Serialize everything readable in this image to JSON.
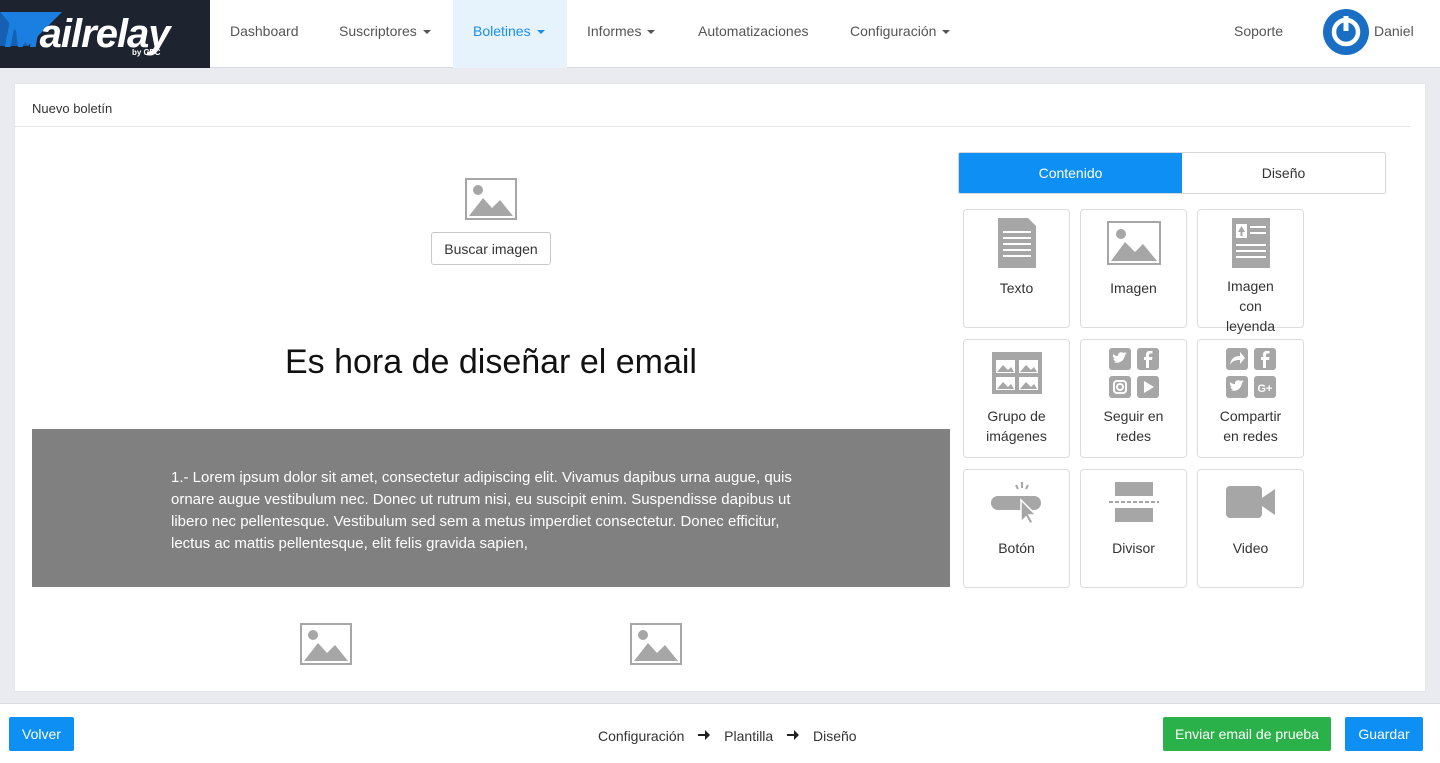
{
  "brand": {
    "name_start": "M",
    "name_rest": "ailrelay",
    "byline": "by CPC"
  },
  "nav": {
    "items": [
      {
        "label": "Dashboard",
        "dropdown": false
      },
      {
        "label": "Suscriptores",
        "dropdown": true
      },
      {
        "label": "Boletines",
        "dropdown": true,
        "active": true
      },
      {
        "label": "Informes",
        "dropdown": true
      },
      {
        "label": "Automatizaciones",
        "dropdown": false
      },
      {
        "label": "Configuración",
        "dropdown": true
      }
    ],
    "support": "Soporte",
    "user": "Daniel"
  },
  "page": {
    "title": "Nuevo boletín"
  },
  "canvas": {
    "search_image_button": "Buscar imagen",
    "heading": "Es hora de diseñar el email",
    "text_block": "1.- Lorem ipsum dolor sit amet, consectetur adipiscing elit. Vivamus dapibus urna augue, quis ornare augue vestibulum nec. Donec ut rutrum nisi, eu suscipit enim. Suspendisse dapibus ut libero nec pellentesque. Vestibulum sed sem a metus imperdiet consectetur. Donec efficitur, lectus ac mattis pellentesque, elit felis gravida sapien,"
  },
  "panel": {
    "tabs": [
      {
        "label": "Contenido",
        "active": true
      },
      {
        "label": "Diseño",
        "active": false
      }
    ],
    "blocks": [
      {
        "icon": "text-icon",
        "label_lines": [
          "Texto"
        ]
      },
      {
        "icon": "image-icon",
        "label_lines": [
          "Imagen"
        ]
      },
      {
        "icon": "image-caption-icon",
        "label_lines": [
          "Imagen",
          "con",
          "leyenda"
        ]
      },
      {
        "icon": "image-group-icon",
        "label_lines": [
          "Grupo de",
          "imágenes"
        ]
      },
      {
        "icon": "follow-social-icon",
        "label_lines": [
          "Seguir en",
          "redes"
        ]
      },
      {
        "icon": "share-social-icon",
        "label_lines": [
          "Compartir",
          "en redes"
        ]
      },
      {
        "icon": "button-icon",
        "label_lines": [
          "Botón"
        ]
      },
      {
        "icon": "divider-icon",
        "label_lines": [
          "Divisor"
        ]
      },
      {
        "icon": "video-icon",
        "label_lines": [
          "Video"
        ]
      }
    ]
  },
  "footer": {
    "back": "Volver",
    "steps": [
      "Configuración",
      "Plantilla",
      "Diseño"
    ],
    "send_test": "Enviar email de prueba",
    "save": "Guardar"
  },
  "colors": {
    "accent": "#0d8ff4",
    "success": "#2bb14a",
    "active_nav_bg": "#e6f3fd",
    "logo_bg": "#1d2430",
    "placeholder_grey": "#a6a6a6",
    "text_block_bg": "#808080"
  }
}
